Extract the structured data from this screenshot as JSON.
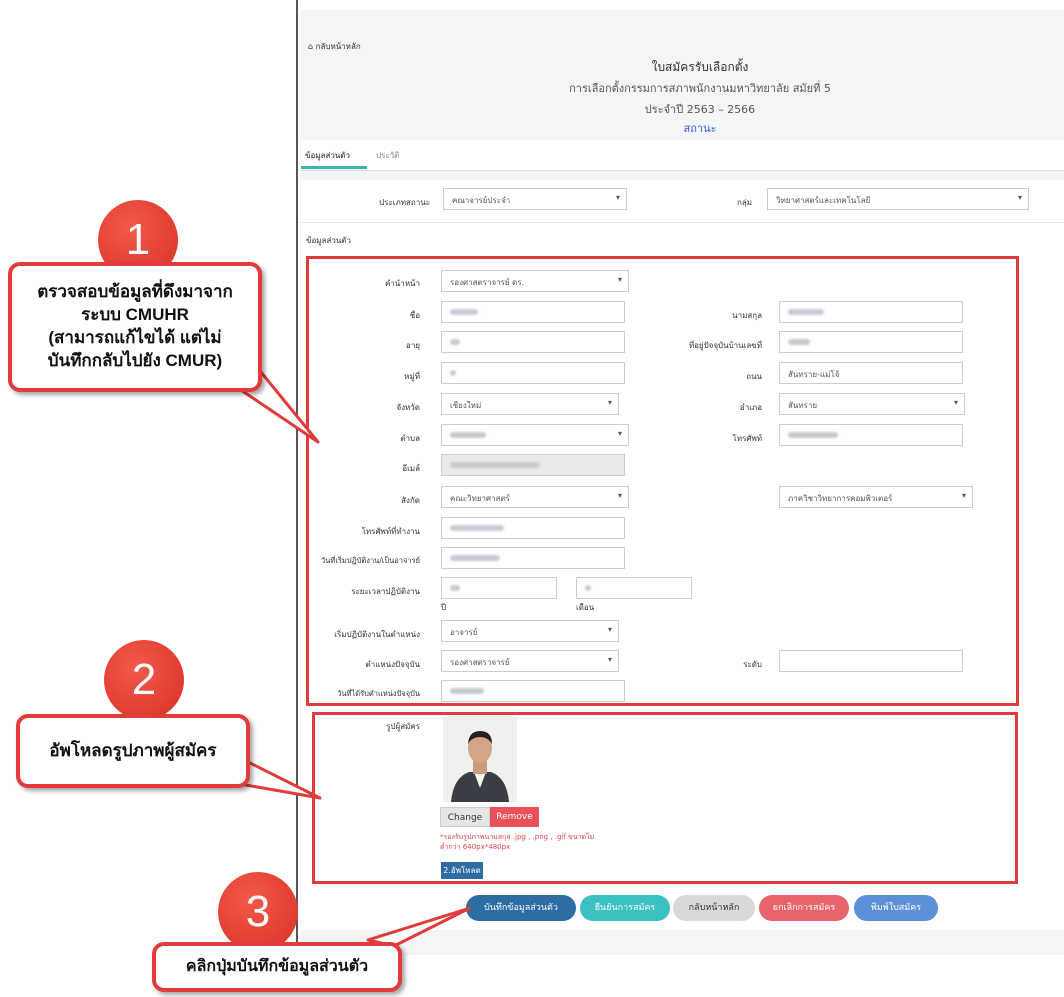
{
  "header": {
    "home_link": "กลับหน้าหลัก",
    "title": "ใบสมัครรับเลือกตั้ง",
    "subtitle": "การเลือกตั้งกรรมการสภาพนักงานมหาวิทยาลัย สมัยที่ 5",
    "term": "ประจำปี 2563 – 2566",
    "status_link": "สถานะ"
  },
  "tabs": [
    "ข้อมูลส่วนตัว",
    "ประวัติ"
  ],
  "top_fields": {
    "type_label": "ประเภทสถานะ",
    "type_value": "คณาจารย์ประจำ",
    "group_label": "กลุ่ม",
    "group_value": "วิทยาศาสตร์และเทคโนโลยี"
  },
  "section_title": "ข้อมูลส่วนตัว",
  "form": {
    "prefix_label": "คำนำหน้า",
    "prefix_value": "รองศาสตราจารย์ ดร.",
    "name_label": "ชื่อ",
    "surname_label": "นามสกุล",
    "age_label": "อายุ",
    "address_label": "ที่อยู่ปัจจุบันบ้านเลขที่",
    "moo_label": "หมู่ที่",
    "road_label": "ถนน",
    "road_value": "สันทราย-แม่โจ้",
    "province_label": "จังหวัด",
    "province_value": "เชียงใหม่",
    "district_label": "อำเภอ",
    "district_value": "สันทราย",
    "subdistrict_label": "ตำบล",
    "phone_label": "โทรศัพท์",
    "email_label": "อีเมล์",
    "affiliation_label": "สังกัด",
    "affiliation_value": "คณะวิทยาศาสตร์",
    "department_value": "ภาควิชาวิทยาการคอมพิวเตอร์",
    "work_phone_label": "โทรศัพท์ที่ทำงาน",
    "start_date_label": "วันที่เริ่มปฏิบัติงาน/เป็นอาจารย์",
    "duration_label": "ระยะเวลาปฏิบัติงาน",
    "year_unit": "ปี",
    "month_unit": "เดือน",
    "start_position_label": "เริ่มปฏิบัติงานในตำแหน่ง",
    "start_position_value": "อาจารย์",
    "current_position_label": "ตำแหน่งปัจจุบัน",
    "current_position_value": "รองศาสตราจารย์",
    "level_label": "ระดับ",
    "current_position_date_label": "วันที่ได้รับตำแหน่งปัจจุบัน"
  },
  "photo": {
    "label": "รูปผู้สมัคร",
    "change_label": "Change",
    "remove_label": "Remove",
    "note_line1": "*รองรับรูปภาพนามสกุล .jpg , .png , .gif ขนาดไม่",
    "note_line2": "ต่ำกว่า 640px*480px",
    "upload_label": "2.อัพโหลด"
  },
  "actions": {
    "save": "บันทึกข้อมูลส่วนตัว",
    "confirm": "ยืนยันการสมัคร",
    "back": "กลับหน้าหลัก",
    "cancel": "ยกเลิกการสมัคร",
    "print": "พิมพ์ใบสมัคร"
  },
  "annotations": {
    "step1_number": "1",
    "step1_line1": "ตรวจสอบข้อมูลที่ดึงมาจาก",
    "step1_line2": "ระบบ CMUHR",
    "step1_line3": "(สามารถแก้ไขได้ แต่ไม่",
    "step1_line4": "บันทึกกลับไปยัง CMUR)",
    "step2_number": "2",
    "step2_text": "อัพโหลดรูปภาพผู้สมัคร",
    "step3_number": "3",
    "step3_text": "คลิกปุ่มบันทึกข้อมูลส่วนตัว"
  },
  "colors": {
    "annotation_red": "#e23b3b",
    "save_button": "#2e6da4",
    "confirm_button": "#3bc0c3",
    "back_button": "#d9d9d9",
    "cancel_button": "#e8646b",
    "print_button": "#5b8fd6",
    "tab_accent": "#3bb5b5"
  }
}
